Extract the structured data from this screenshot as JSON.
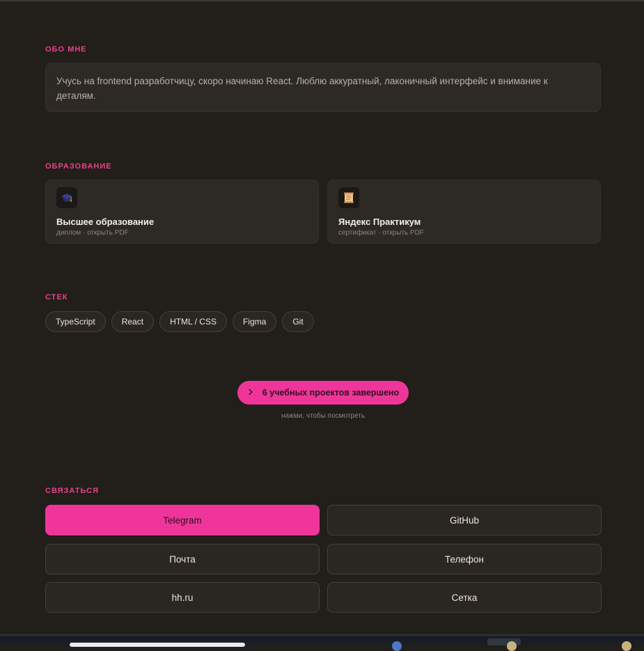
{
  "about": {
    "heading": "ОБО МНЕ",
    "text": "Учусь на frontend разработчицу, скоро начинаю React. Люблю аккуратный, лаконичный интерфейс и внимание к деталям."
  },
  "education": {
    "heading": "ОБРАЗОВАНИЕ",
    "items": [
      {
        "icon": "graduation-cap-icon",
        "title": "Высшее образование",
        "subtitle": "диплом · открыть PDF"
      },
      {
        "icon": "scroll-icon",
        "title": "Яндекс Практикум",
        "subtitle": "сертификат · открыть PDF"
      }
    ]
  },
  "stack": {
    "heading": "СТЕК",
    "items": [
      "TypeScript",
      "React",
      "HTML / CSS",
      "Figma",
      "Git"
    ]
  },
  "projects": {
    "button_label": "6 учебных проектов завершено",
    "hint": "нажми, чтобы посмотреть",
    "icon": "chevron-right-icon"
  },
  "contacts": {
    "heading": "СВЯЗАТЬСЯ",
    "items": [
      "Telegram",
      "GitHub",
      "Почта",
      "Телефон",
      "hh.ru",
      "Сетка"
    ]
  },
  "colors": {
    "accent": "#f0359a",
    "background": "#221e1a",
    "card": "#2d2924",
    "heading": "#e8418f"
  }
}
